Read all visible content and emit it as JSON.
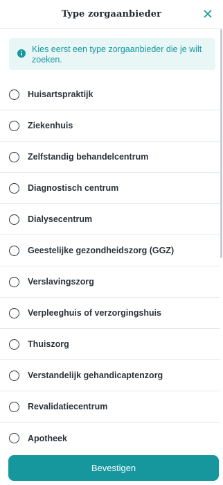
{
  "colors": {
    "accent": "#16979e",
    "info_background": "#e8f6f6",
    "text": "#2a323a",
    "divider": "#e6e8ea"
  },
  "header": {
    "title": "Type zorgaanbieder",
    "close_icon": "close-icon"
  },
  "info": {
    "icon": "info-icon",
    "text": "Kies eerst een type zorgaanbieder die je wilt zoeken."
  },
  "options": [
    {
      "label": "Huisartspraktijk",
      "selected": false
    },
    {
      "label": "Ziekenhuis",
      "selected": false
    },
    {
      "label": "Zelfstandig behandelcentrum",
      "selected": false
    },
    {
      "label": "Diagnostisch centrum",
      "selected": false
    },
    {
      "label": "Dialysecentrum",
      "selected": false
    },
    {
      "label": "Geestelijke gezondheidszorg (GGZ)",
      "selected": false
    },
    {
      "label": "Verslavingszorg",
      "selected": false
    },
    {
      "label": "Verpleeghuis of verzorgingshuis",
      "selected": false
    },
    {
      "label": "Thuiszorg",
      "selected": false
    },
    {
      "label": "Verstandelijk gehandicaptenzorg",
      "selected": false
    },
    {
      "label": "Revalidatiecentrum",
      "selected": false
    },
    {
      "label": "Apotheek",
      "selected": false
    }
  ],
  "footer": {
    "confirm_label": "Bevestigen"
  }
}
